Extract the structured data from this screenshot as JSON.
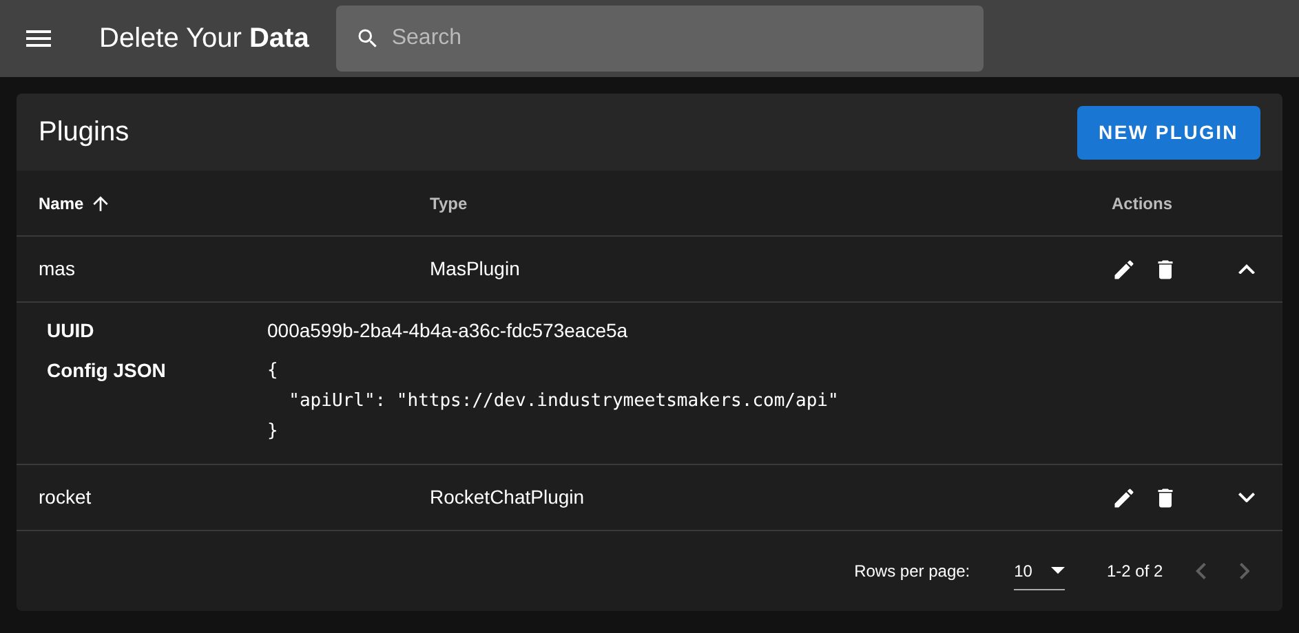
{
  "app_bar": {
    "title": "Delete Your **Data**",
    "search": {
      "placeholder": "Search"
    }
  },
  "card": {
    "title": "Plugins",
    "new_button": "NEW PLUGIN",
    "table": {
      "columns": [
        {
          "label": "Name",
          "sorted": true
        },
        {
          "label": "Type",
          "sorted": false
        },
        {
          "label": "Actions",
          "sorted": false
        }
      ],
      "rows": [
        {
          "name": "mas",
          "type": "MasPlugin",
          "expanded": true,
          "details": {
            "uuid_label": "UUID",
            "uuid": "000a599b-2ba4-4b4a-a36c-fdc573eace5a",
            "config_label": "Config JSON",
            "config_lines": [
              "{",
              "  \"apiUrl\": \"https://dev.industrymeetsmakers.com/api\"",
              "}"
            ]
          }
        },
        {
          "name": "rocket",
          "type": "RocketChatPlugin",
          "expanded": false
        }
      ]
    },
    "pagination": {
      "rows_per_page_label": "Rows per page:",
      "rows_per_page": "10",
      "range": "1-2 of 2",
      "prev_disabled": true,
      "next_disabled": true
    }
  }
}
